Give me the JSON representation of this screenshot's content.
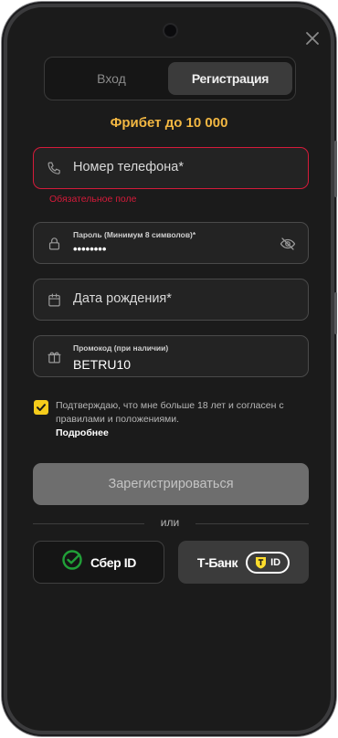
{
  "tabs": {
    "login_label": "Вход",
    "register_label": "Регистрация",
    "active": "register"
  },
  "promo": {
    "freebet_text": "Фрибет до 10 000"
  },
  "form": {
    "phone": {
      "placeholder": "Номер телефона*",
      "value": "",
      "error": "Обязательное поле",
      "icon": "phone-icon"
    },
    "password": {
      "label": "Пароль (Минимум 8 символов)*",
      "value": "••••••••",
      "icon": "lock-icon",
      "toggle_icon": "eye-off-icon"
    },
    "birthdate": {
      "placeholder": "Дата рождения*",
      "value": "",
      "icon": "calendar-icon"
    },
    "promocode": {
      "label": "Промокод (при наличии)",
      "value": "BETRU10",
      "icon": "gift-icon"
    }
  },
  "consent": {
    "checked": true,
    "text": "Подтверждаю, что мне больше 18 лет и согласен с правилами и положениями.",
    "more_link": "Подробнее"
  },
  "submit": {
    "label": "Зарегистрироваться"
  },
  "divider": {
    "label": "или"
  },
  "social": {
    "sber_label": "Сбер ID",
    "tbank_label": "Т-Банк",
    "tbank_badge": "ID"
  },
  "colors": {
    "accent": "#f2b742",
    "error": "#d51b3a",
    "checkbox": "#f5cc1b",
    "sber_green": "#21a038",
    "tbank_yellow": "#ffdd2d"
  }
}
